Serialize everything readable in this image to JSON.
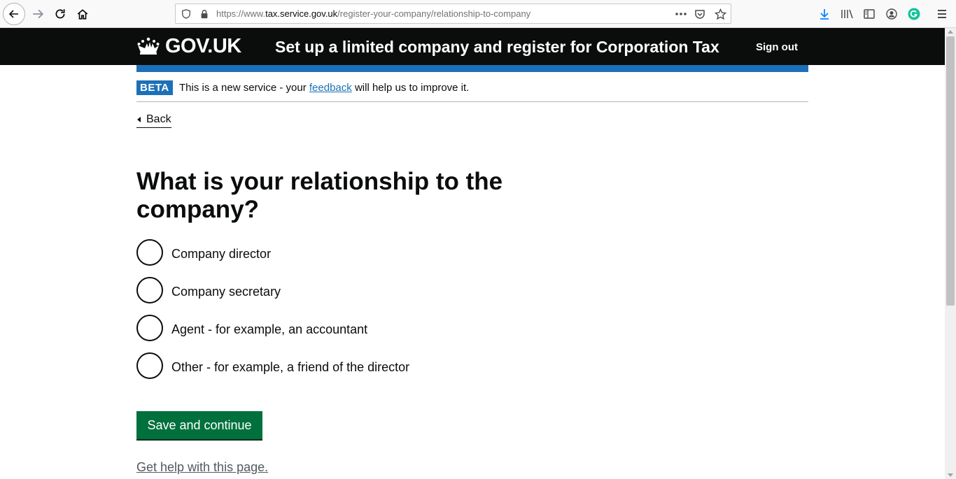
{
  "browser": {
    "url_prefix": "https://www.",
    "url_host": "tax.service.gov.uk",
    "url_path": "/register-your-company/relationship-to-company"
  },
  "header": {
    "logo_text": "GOV.UK",
    "service_name": "Set up a limited company and register for Corporation Tax",
    "sign_out": "Sign out"
  },
  "beta": {
    "tag": "BETA",
    "text_before": "This is a new service - your ",
    "link": "feedback",
    "text_after": " will help us to improve it."
  },
  "back_link": "Back",
  "question": "What is your relationship to the company?",
  "options": [
    {
      "label": "Company director"
    },
    {
      "label": "Company secretary"
    },
    {
      "label": "Agent - for example, an accountant"
    },
    {
      "label": "Other - for example, a friend of the director"
    }
  ],
  "save_button": "Save and continue",
  "help_link": "Get help with this page.",
  "colors": {
    "header_bg": "#0b0c0c",
    "brand_blue": "#1d70b8",
    "button_green": "#00703c"
  }
}
